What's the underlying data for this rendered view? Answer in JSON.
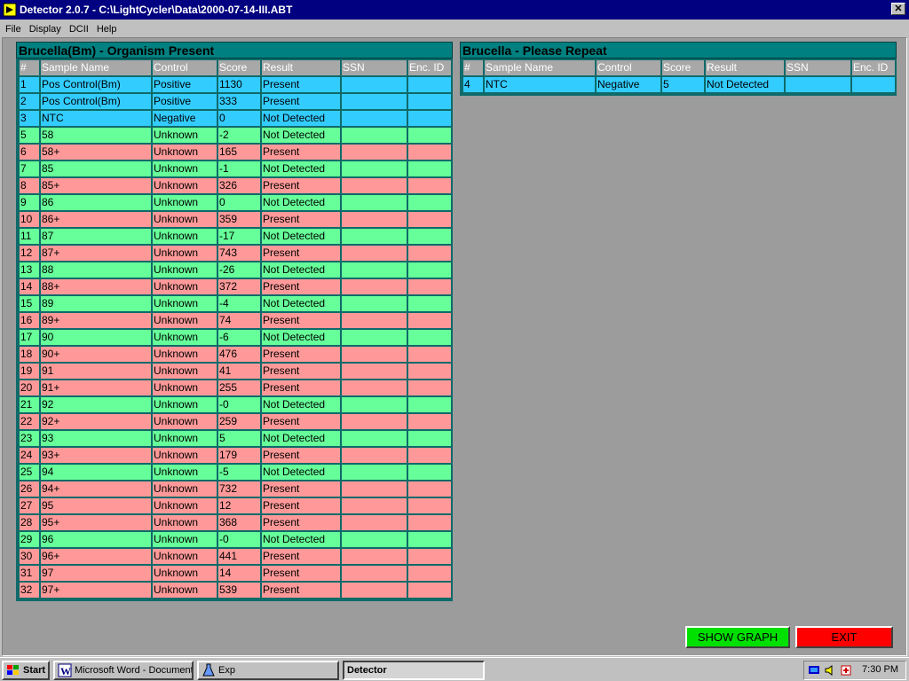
{
  "window": {
    "title": "Detector 2.0.7 - C:\\LightCycler\\Data\\2000-07-14-III.ABT",
    "close_label": "✕"
  },
  "menu": [
    "File",
    "Display",
    "DCII",
    "Help"
  ],
  "columns": [
    "#",
    "Sample Name",
    "Control",
    "Score",
    "Result",
    "SSN",
    "Enc. ID"
  ],
  "left_panel": {
    "title": "Brucella(Bm) - Organism Present",
    "rows": [
      {
        "n": "1",
        "name": "Pos Control(Bm)",
        "control": "Positive",
        "score": "1130",
        "result": "Present",
        "ssn": "",
        "enc": "",
        "type": "control"
      },
      {
        "n": "2",
        "name": "Pos Control(Bm)",
        "control": "Positive",
        "score": "333",
        "result": "Present",
        "ssn": "",
        "enc": "",
        "type": "control"
      },
      {
        "n": "3",
        "name": "NTC",
        "control": "Negative",
        "score": "0",
        "result": "Not Detected",
        "ssn": "",
        "enc": "",
        "type": "control"
      },
      {
        "n": "5",
        "name": "58",
        "control": "Unknown",
        "score": "-2",
        "result": "Not Detected",
        "ssn": "",
        "enc": "",
        "type": "negative"
      },
      {
        "n": "6",
        "name": "58+",
        "control": "Unknown",
        "score": "165",
        "result": "Present",
        "ssn": "",
        "enc": "",
        "type": "positive"
      },
      {
        "n": "7",
        "name": "85",
        "control": "Unknown",
        "score": "-1",
        "result": "Not Detected",
        "ssn": "",
        "enc": "",
        "type": "negative"
      },
      {
        "n": "8",
        "name": "85+",
        "control": "Unknown",
        "score": "326",
        "result": "Present",
        "ssn": "",
        "enc": "",
        "type": "positive"
      },
      {
        "n": "9",
        "name": "86",
        "control": "Unknown",
        "score": "0",
        "result": "Not Detected",
        "ssn": "",
        "enc": "",
        "type": "negative"
      },
      {
        "n": "10",
        "name": "86+",
        "control": "Unknown",
        "score": "359",
        "result": "Present",
        "ssn": "",
        "enc": "",
        "type": "positive"
      },
      {
        "n": "11",
        "name": "87",
        "control": "Unknown",
        "score": "-17",
        "result": "Not Detected",
        "ssn": "",
        "enc": "",
        "type": "negative"
      },
      {
        "n": "12",
        "name": "87+",
        "control": "Unknown",
        "score": "743",
        "result": "Present",
        "ssn": "",
        "enc": "",
        "type": "positive"
      },
      {
        "n": "13",
        "name": "88",
        "control": "Unknown",
        "score": "-26",
        "result": "Not Detected",
        "ssn": "",
        "enc": "",
        "type": "negative"
      },
      {
        "n": "14",
        "name": "88+",
        "control": "Unknown",
        "score": "372",
        "result": "Present",
        "ssn": "",
        "enc": "",
        "type": "positive"
      },
      {
        "n": "15",
        "name": "89",
        "control": "Unknown",
        "score": "-4",
        "result": "Not Detected",
        "ssn": "",
        "enc": "",
        "type": "negative"
      },
      {
        "n": "16",
        "name": "89+",
        "control": "Unknown",
        "score": "74",
        "result": "Present",
        "ssn": "",
        "enc": "",
        "type": "positive"
      },
      {
        "n": "17",
        "name": "90",
        "control": "Unknown",
        "score": "-6",
        "result": "Not Detected",
        "ssn": "",
        "enc": "",
        "type": "negative"
      },
      {
        "n": "18",
        "name": "90+",
        "control": "Unknown",
        "score": "476",
        "result": "Present",
        "ssn": "",
        "enc": "",
        "type": "positive"
      },
      {
        "n": "19",
        "name": "91",
        "control": "Unknown",
        "score": "41",
        "result": "Present",
        "ssn": "",
        "enc": "",
        "type": "positive"
      },
      {
        "n": "20",
        "name": "91+",
        "control": "Unknown",
        "score": "255",
        "result": "Present",
        "ssn": "",
        "enc": "",
        "type": "positive"
      },
      {
        "n": "21",
        "name": "92",
        "control": "Unknown",
        "score": "-0",
        "result": "Not Detected",
        "ssn": "",
        "enc": "",
        "type": "negative"
      },
      {
        "n": "22",
        "name": "92+",
        "control": "Unknown",
        "score": "259",
        "result": "Present",
        "ssn": "",
        "enc": "",
        "type": "positive"
      },
      {
        "n": "23",
        "name": "93",
        "control": "Unknown",
        "score": "5",
        "result": "Not Detected",
        "ssn": "",
        "enc": "",
        "type": "negative"
      },
      {
        "n": "24",
        "name": "93+",
        "control": "Unknown",
        "score": "179",
        "result": "Present",
        "ssn": "",
        "enc": "",
        "type": "positive"
      },
      {
        "n": "25",
        "name": "94",
        "control": "Unknown",
        "score": "-5",
        "result": "Not Detected",
        "ssn": "",
        "enc": "",
        "type": "negative"
      },
      {
        "n": "26",
        "name": "94+",
        "control": "Unknown",
        "score": "732",
        "result": "Present",
        "ssn": "",
        "enc": "",
        "type": "positive"
      },
      {
        "n": "27",
        "name": "95",
        "control": "Unknown",
        "score": "12",
        "result": "Present",
        "ssn": "",
        "enc": "",
        "type": "positive"
      },
      {
        "n": "28",
        "name": "95+",
        "control": "Unknown",
        "score": "368",
        "result": "Present",
        "ssn": "",
        "enc": "",
        "type": "positive"
      },
      {
        "n": "29",
        "name": "96",
        "control": "Unknown",
        "score": "-0",
        "result": "Not Detected",
        "ssn": "",
        "enc": "",
        "type": "negative"
      },
      {
        "n": "30",
        "name": "96+",
        "control": "Unknown",
        "score": "441",
        "result": "Present",
        "ssn": "",
        "enc": "",
        "type": "positive"
      },
      {
        "n": "31",
        "name": "97",
        "control": "Unknown",
        "score": "14",
        "result": "Present",
        "ssn": "",
        "enc": "",
        "type": "positive"
      },
      {
        "n": "32",
        "name": "97+",
        "control": "Unknown",
        "score": "539",
        "result": "Present",
        "ssn": "",
        "enc": "",
        "type": "positive"
      }
    ]
  },
  "right_panel": {
    "title": "Brucella - Please Repeat",
    "rows": [
      {
        "n": "4",
        "name": "NTC",
        "control": "Negative",
        "score": "5",
        "result": "Not Detected",
        "ssn": "",
        "enc": "",
        "type": "control"
      }
    ]
  },
  "buttons": {
    "show_graph": "SHOW GRAPH",
    "exit": "EXIT"
  },
  "taskbar": {
    "start": "Start",
    "items": [
      {
        "label": "Microsoft Word - Document1",
        "active": false
      },
      {
        "label": "Exp",
        "active": false
      },
      {
        "label": "Detector",
        "active": true
      }
    ],
    "clock": "7:30 PM"
  },
  "colors": {
    "control_row": "#33ccff",
    "not_detected_row": "#66ff99",
    "present_row": "#ff9999",
    "panel_header": "#008080",
    "show_graph_button": "#00e000",
    "exit_button": "#ff0000"
  },
  "icons": [
    "app-icon",
    "close-icon",
    "windows-logo-icon",
    "word-icon",
    "exp-icon",
    "network-icon",
    "speaker-icon",
    "tray-app-icon"
  ]
}
